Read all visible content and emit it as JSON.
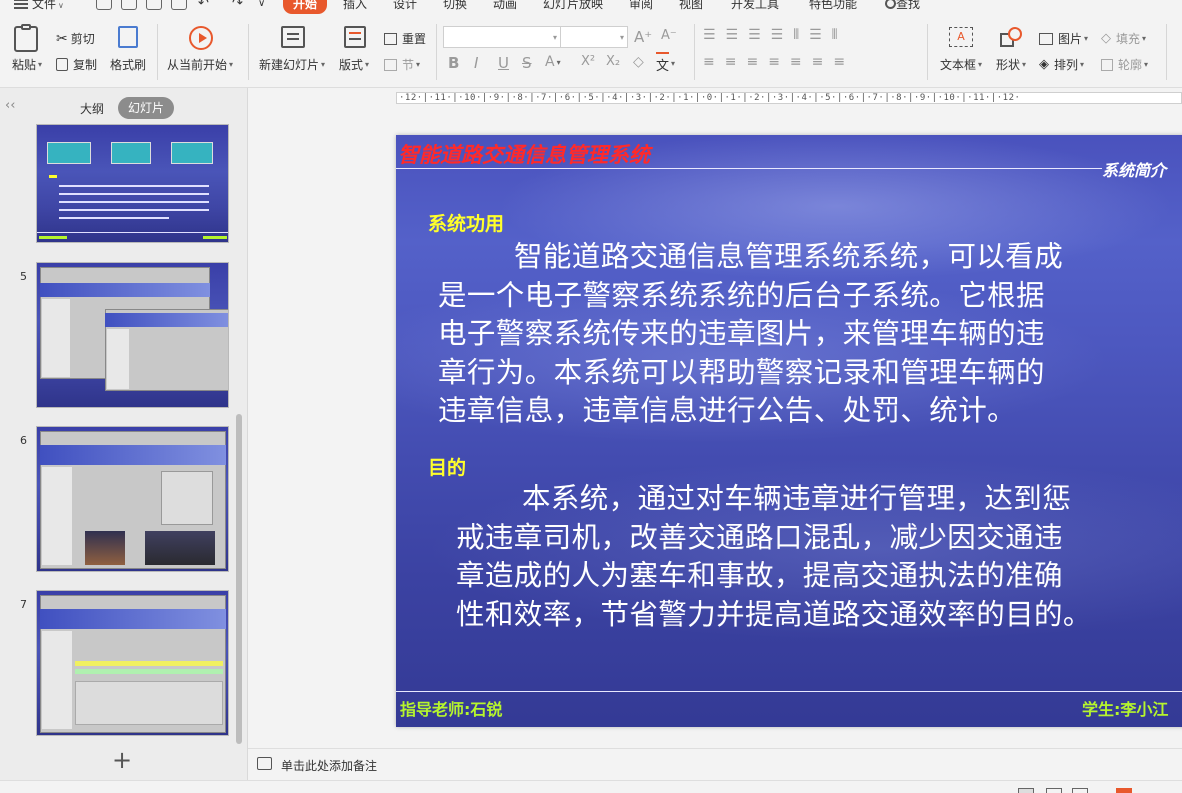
{
  "menu": {
    "file": "文件",
    "tabs": [
      "开始",
      "插入",
      "设计",
      "切换",
      "动画",
      "幻灯片放映",
      "审阅",
      "视图",
      "开发工具",
      "特色功能"
    ],
    "active_tab": "开始",
    "search": "查找"
  },
  "ribbon": {
    "paste": "粘贴",
    "cut": "剪切",
    "copy": "复制",
    "format_painter": "格式刷",
    "from_current": "从当前开始",
    "new_slide": "新建幻灯片",
    "layout": "版式",
    "reset": "重置",
    "section": "节",
    "textbox": "文本框",
    "shape": "形状",
    "picture": "图片",
    "arrange": "排列",
    "fill": "填充",
    "outline": "轮廓",
    "wen_glyph": "文",
    "clear_fmt_glyph": "◇"
  },
  "left_panel": {
    "tab_outline": "大纲",
    "tab_slides": "幻灯片",
    "slide_numbers": [
      "5",
      "6",
      "7"
    ],
    "add_glyph": "+",
    "collapse_glyph": "‹‹"
  },
  "ruler_text": "·12·|·11·|·10·|·9·|·8·|·7·|·6·|·5·|·4·|·3·|·2·|·1·|·0·|·1·|·2·|·3·|·4·|·5·|·6·|·7·|·8·|·9·|·10·|·11·|·12·",
  "slide": {
    "title": "智能道路交通信息管理系统",
    "subtitle": "系统简介",
    "section1_heading": "系统功用",
    "section1_lines": [
      "智能道路交通信息管理系统系统，可以看成",
      "是一个电子警察系统系统的后台子系统。它根据",
      "电子警察系统传来的违章图片，来管理车辆的违",
      "章行为。本系统可以帮助警察记录和管理车辆的",
      "违章信息，违章信息进行公告、处罚、统计。"
    ],
    "section2_heading": "目的",
    "section2_lines": [
      "本系统，通过对车辆违章进行管理，达到惩",
      "戒违章司机，改善交通路口混乱，减少因交通违",
      "章造成的人为塞车和事故，提高交通执法的准确",
      "性和效率，节省警力并提高道路交通效率的目的。"
    ],
    "footer_left": "指导老师:石锐",
    "footer_right": "学生:李小江"
  },
  "notes_placeholder": "单击此处添加备注",
  "colors": {
    "accent": "#e8582c",
    "slide_title": "#ff2a2a",
    "slide_heading": "#ffff2b",
    "slide_footer": "#b6f52d",
    "slide_bg": "#4a52bd"
  }
}
